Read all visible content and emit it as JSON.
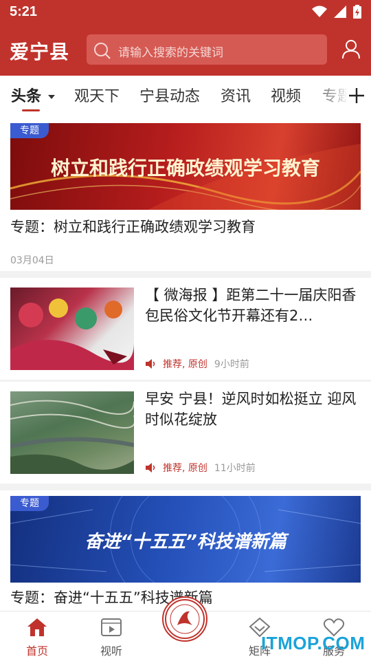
{
  "status_bar": {
    "time": "5:21",
    "icons": [
      "wifi-icon",
      "signal-icon",
      "battery-charging-icon"
    ]
  },
  "header": {
    "app_title": "爱宁县",
    "search_placeholder": "请输入搜索的关键词",
    "icons": [
      "search-icon",
      "user-icon"
    ]
  },
  "tabs": {
    "items": [
      {
        "label": "头条",
        "active": true,
        "dropdown": true
      },
      {
        "label": "观天下"
      },
      {
        "label": "宁县动态"
      },
      {
        "label": "资讯"
      },
      {
        "label": "视频"
      },
      {
        "label": "专题"
      }
    ],
    "add_icon": "plus-icon"
  },
  "feed": [
    {
      "type": "topic",
      "tag": "专题",
      "banner_text": "树立和践行正确政绩观学习教育",
      "title": "专题：树立和践行正确政绩观学习教育",
      "date": "03月04日",
      "banner_colors": [
        "#9b1010",
        "#d4342a"
      ]
    },
    {
      "type": "news",
      "title": "【 微海报 】距第二十一届庆阳香包民俗文化节开幕还有2…",
      "tags": "推荐, 原创",
      "time": "9小时前"
    },
    {
      "type": "news",
      "title": "早安  宁县！逆风时如松挺立 迎风时似花绽放",
      "tags": "推荐, 原创",
      "time": "11小时前"
    },
    {
      "type": "topic",
      "tag": "专题",
      "banner_text": "奋进“十五五”科技谱新篇",
      "title": "专题：奋进“十五五”科技谱新篇",
      "banner_colors": [
        "#1f3f9a",
        "#3a6ad8"
      ]
    }
  ],
  "bottom_nav": [
    {
      "label": "首页",
      "icon": "home-icon",
      "active": true
    },
    {
      "label": "视听",
      "icon": "video-icon"
    },
    {
      "label": "",
      "icon": "emblem-icon"
    },
    {
      "label": "矩阵",
      "icon": "diamond-icon"
    },
    {
      "label": "服务",
      "icon": "heart-icon"
    }
  ],
  "watermark": "ITMOP.COM",
  "colors": {
    "brand_red": "#c0332c",
    "tag_blue": "#3b5bd0",
    "watermark_blue": "#1aa3d9"
  }
}
